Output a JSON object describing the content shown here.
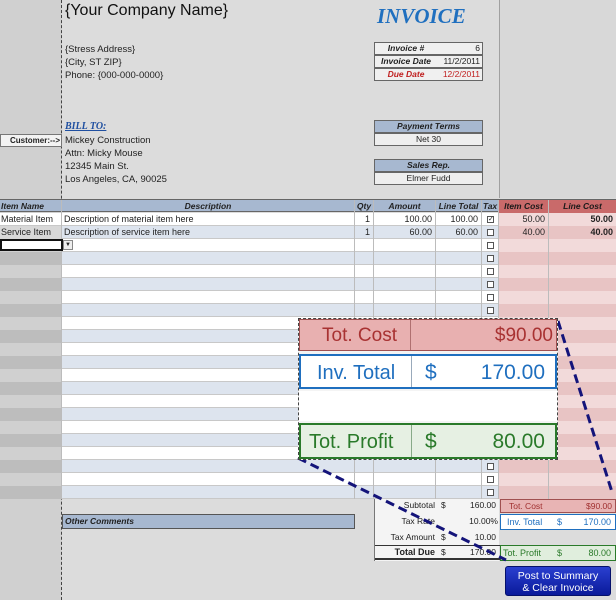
{
  "company": {
    "name": "{Your Company Name}",
    "address": "{Stress Address}",
    "city": "{City, ST  ZIP}",
    "phone": "Phone: {000-000-0000}"
  },
  "invoice": {
    "title": "INVOICE",
    "number_label": "Invoice #",
    "number": "6",
    "date_label": "Invoice Date",
    "date": "11/2/2011",
    "due_label": "Due Date",
    "due": "12/2/2011"
  },
  "customer": {
    "label": "Customer:-->",
    "bill_to": "BILL TO:",
    "name": "Mickey Construction",
    "attn": "Attn: Micky Mouse",
    "street": "12345 Main St.",
    "city": "Los Angeles, CA, 90025"
  },
  "terms": {
    "label": "Payment Terms",
    "value": "Net 30"
  },
  "rep": {
    "label": "Sales Rep.",
    "value": "Elmer Fudd"
  },
  "table": {
    "headers": {
      "item": "Item Name",
      "desc": "Description",
      "qty": "Qty",
      "amount": "Amount",
      "line": "Line Total",
      "tax": "Tax",
      "item_cost": "Item Cost",
      "line_cost": "Line Cost"
    },
    "rows": [
      {
        "item": "Material Item",
        "desc": "Description of material item here",
        "qty": "1",
        "amount": "100.00",
        "line": "100.00",
        "tax": true,
        "item_cost": "50.00",
        "line_cost": "50.00"
      },
      {
        "item": "Service Item",
        "desc": "Description of service item here",
        "qty": "1",
        "amount": "60.00",
        "line": "60.00",
        "tax": false,
        "item_cost": "40.00",
        "line_cost": "40.00"
      }
    ]
  },
  "comments": {
    "label": "Other Comments"
  },
  "totals": {
    "subtotal_label": "Subtotal",
    "currency": "$",
    "subtotal": "160.00",
    "taxrate_label": "Tax Rate",
    "taxrate": "10.00%",
    "taxamount_label": "Tax Amount",
    "taxamount": "10.00",
    "totaldue_label": "Total Due",
    "totaldue": "170.00"
  },
  "side_totals": {
    "cost_label": "Tot. Cost",
    "cost": "$90.00",
    "inv_label": "Inv. Total",
    "inv": "170.00",
    "profit_label": "Tot. Profit",
    "profit": "80.00"
  },
  "zoom": {
    "cost_label": "Tot. Cost",
    "cost": "$90.00",
    "inv_label": "Inv. Total",
    "currency": "$",
    "inv": "170.00",
    "profit_label": "Tot. Profit",
    "profit": "80.00"
  },
  "button": {
    "line1": "Post to Summary",
    "line2": "& Clear Invoice"
  },
  "colors": {
    "blue": "#1f6fbf",
    "red": "#b03030",
    "green": "#2a7a2a",
    "header": "#a7b8d0",
    "cost_header": "#c96a6a"
  }
}
